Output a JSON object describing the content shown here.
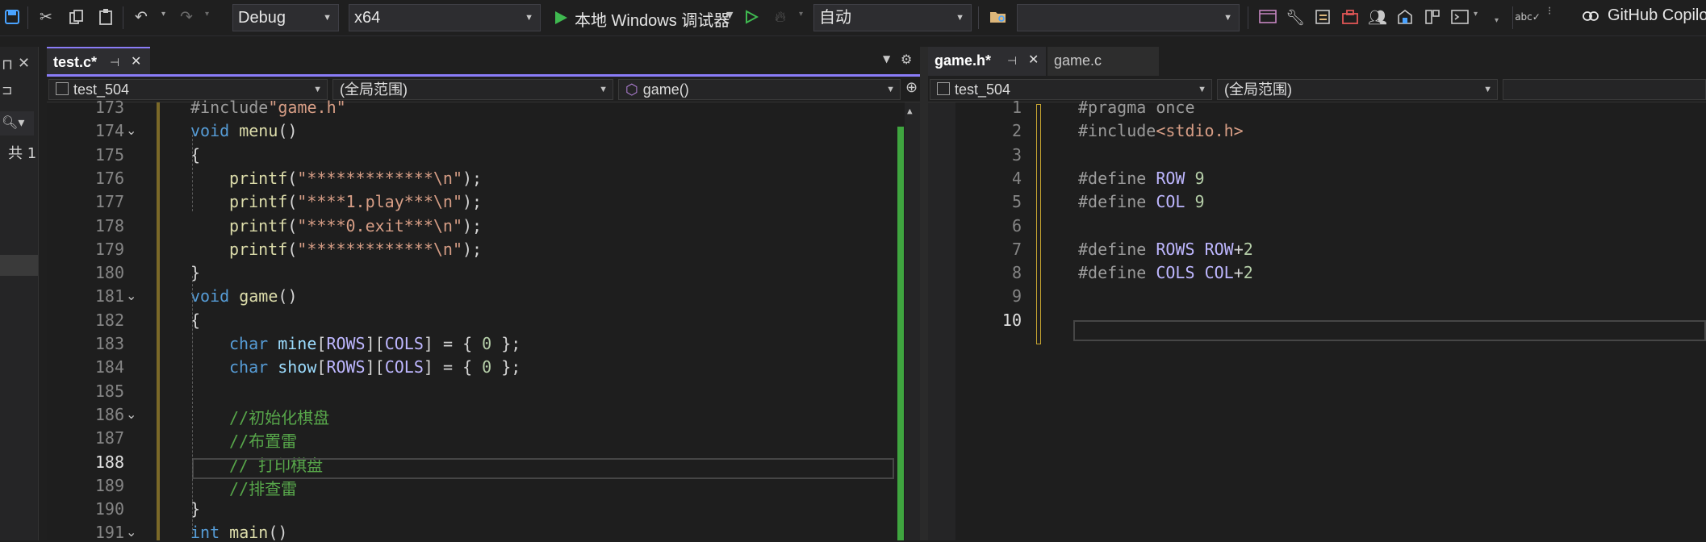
{
  "toolbar": {
    "config": "Debug",
    "platform": "x64",
    "run_label": "本地 Windows 调试器",
    "auto_label": "自动",
    "search_placeholder": "",
    "github": "GitHub Copilo"
  },
  "left_sidebar": {
    "glyph": "共 1"
  },
  "left_editor": {
    "tabs": [
      {
        "label": "test.c*",
        "active": true
      }
    ],
    "nav": {
      "project": "test_504",
      "scope": "(全局范围)",
      "member": "game()"
    },
    "lines": [
      {
        "n": "173",
        "text": "#include\"game.h\""
      },
      {
        "n": "174",
        "text": "void menu()"
      },
      {
        "n": "175",
        "text": "{"
      },
      {
        "n": "176",
        "text": "printf(\"*************\\n\");"
      },
      {
        "n": "177",
        "text": "printf(\"****1.play***\\n\");"
      },
      {
        "n": "178",
        "text": "printf(\"****0.exit***\\n\");"
      },
      {
        "n": "179",
        "text": "printf(\"*************\\n\");"
      },
      {
        "n": "180",
        "text": "}"
      },
      {
        "n": "181",
        "text": "void game()"
      },
      {
        "n": "182",
        "text": "{"
      },
      {
        "n": "183",
        "text": "char mine[ROWS][COLS] = { 0 };"
      },
      {
        "n": "184",
        "text": "char show[ROWS][COLS] = { 0 };"
      },
      {
        "n": "185",
        "text": ""
      },
      {
        "n": "186",
        "text": "//初始化棋盘"
      },
      {
        "n": "187",
        "text": "//布置雷"
      },
      {
        "n": "188",
        "text": "// 打印棋盘"
      },
      {
        "n": "189",
        "text": "//排查雷"
      },
      {
        "n": "190",
        "text": "}"
      },
      {
        "n": "191",
        "text": "int main()"
      }
    ],
    "current_line": "188"
  },
  "right_editor": {
    "tabs": [
      {
        "label": "game.h*",
        "active": true
      },
      {
        "label": "game.c",
        "active": false
      }
    ],
    "nav": {
      "project": "test_504",
      "scope": "(全局范围)"
    },
    "lines": [
      {
        "n": "1",
        "text": "#pragma once"
      },
      {
        "n": "2",
        "text": "#include<stdio.h>"
      },
      {
        "n": "3",
        "text": ""
      },
      {
        "n": "4",
        "text": "#define ROW 9"
      },
      {
        "n": "5",
        "text": "#define COL 9"
      },
      {
        "n": "6",
        "text": ""
      },
      {
        "n": "7",
        "text": "#define ROWS ROW+2"
      },
      {
        "n": "8",
        "text": "#define COLS COL+2"
      },
      {
        "n": "9",
        "text": ""
      },
      {
        "n": "10",
        "text": ""
      }
    ],
    "current_line": "10"
  },
  "icons": [
    "save-icon",
    "cut-icon",
    "copy-icon",
    "paste-icon",
    "undo-icon",
    "redo-icon",
    "play-icon",
    "play-outline-icon",
    "hot-reload-icon",
    "folder-search-icon",
    "wrench-icon",
    "github-copilot-icon"
  ]
}
